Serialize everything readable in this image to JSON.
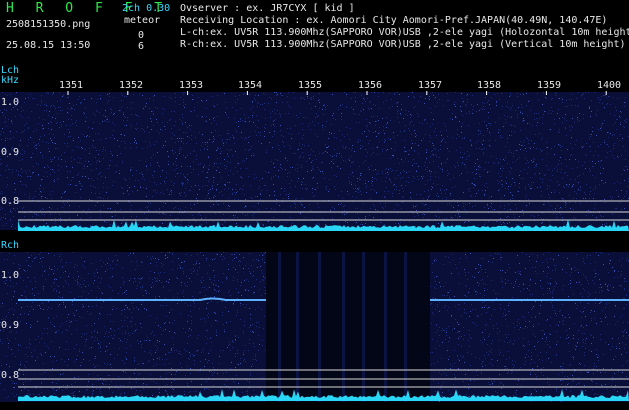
{
  "header": {
    "brand": "H R O F F T",
    "version": "2ch 0.30",
    "filename": "2508151350.png",
    "meteor_label": "meteor",
    "date": "25.08.15 13:50",
    "counts": [
      "0",
      "6"
    ],
    "info_lines": [
      "Ovserver           : ex. JR7CYX [ kid ]",
      "Receiving Location : ex. Aomori City Aomori-Pref.JAPAN(40.49N, 140.47E)",
      "L-ch:ex. UV5R 113.900Mhz(SAPPORO VOR)USB ,2-ele yagi (Holozontal 10m height)",
      "R-ch:ex. UV5R 113.900Mhz(SAPPORO VOR)USB ,2-ele yagi (Vertical 10m height)"
    ]
  },
  "panels": {
    "left_label": "Lch",
    "unit_label": "kHz",
    "right_label": "Rch",
    "x_ticks": [
      "1351",
      "1352",
      "1353",
      "1354",
      "1355",
      "1356",
      "1357",
      "1358",
      "1359",
      "1400"
    ],
    "y_ticks": [
      "1.0",
      "0.9",
      "0.8"
    ]
  },
  "colors": {
    "noise": "#1c2b7a",
    "carrier": "#5fb0ff",
    "level": "#29d6f5",
    "grid": "#d8d8d8",
    "header_green": "#2ee84a"
  }
}
